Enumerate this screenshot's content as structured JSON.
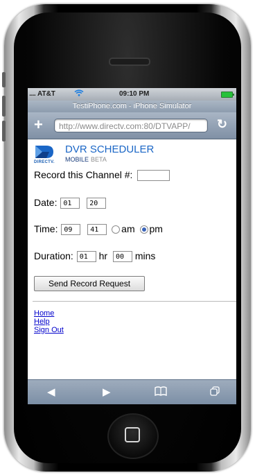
{
  "status": {
    "carrier": "AT&T",
    "time": "09:10 PM"
  },
  "browser": {
    "title": "TestiPhone.com - iPhone Simulator",
    "url": "http://www.directv.com:80/DTVAPP/"
  },
  "header": {
    "logo_text": "DIRECTV.",
    "title": "DVR SCHEDULER",
    "subtitle": "MOBILE",
    "beta": "BETA"
  },
  "form": {
    "channel_label": "Record this Channel #:",
    "channel_value": "",
    "date_label": "Date:",
    "date_month": "01",
    "date_day": "20",
    "time_label": "Time:",
    "time_hour": "09",
    "time_minute": "41",
    "am_label": "am",
    "pm_label": "pm",
    "ampm_selected": "pm",
    "duration_label": "Duration:",
    "duration_hr": "01",
    "hr_label": "hr",
    "duration_min": "00",
    "mins_label": "mins",
    "submit_label": "Send Record Request"
  },
  "links": [
    "Home",
    "Help",
    "Sign Out"
  ],
  "colors": {
    "accent": "#1a66c6",
    "link": "#0000cc",
    "radio_selected": "#3a64b8"
  },
  "icons": {
    "wifi": "wifi-icon",
    "battery": "battery-icon",
    "add_bookmark": "plus-icon",
    "reload": "reload-icon",
    "back": "back-arrow-icon",
    "forward": "forward-arrow-icon",
    "bookmarks": "book-icon",
    "pages": "pages-icon"
  }
}
